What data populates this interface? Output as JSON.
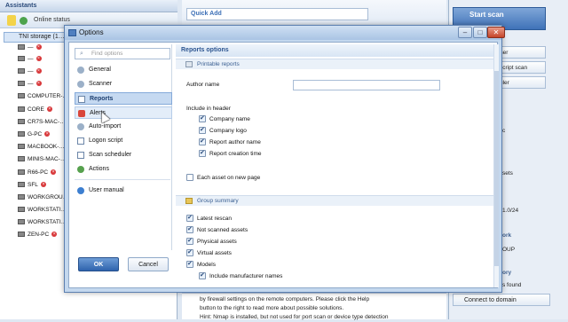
{
  "app": {
    "assistants_title": "Assistants",
    "online_status": "Online status",
    "quick_add": "Quick Add",
    "tree_root": "TNI storage (1…",
    "tree_items": [
      "—",
      "—",
      "—",
      "—",
      "COMPUTER-…",
      "CORE",
      "CR7S-MAC-…",
      "G-PC",
      "MACBOOK-…",
      "MINIS-MAC-…",
      "R66-PC",
      "SFL",
      "WORKGROU…",
      "WORKSTATI…",
      "WORKSTATI…",
      "ZEN-PC"
    ],
    "start_scan": "Start scan",
    "right_buttons": [
      "ner",
      "script scan",
      "uler"
    ],
    "right_texts": [
      "c",
      "sets",
      "1.0/24",
      "ork",
      "OUP",
      "ory",
      "s found"
    ],
    "connect_to_domain": "Connect to domain",
    "bottom_info_1": "by firewall settings on the remote computers. Please click the Help",
    "bottom_info_2": "button to the right to read more about possible solutions.",
    "bottom_info_3": "Hint: Nmap is installed, but not used for port scan or device type detection"
  },
  "dialog": {
    "title": "Options",
    "find_placeholder": "Find options",
    "nav_items": [
      "General",
      "Scanner",
      "Reports",
      "Alerts",
      "Auto-import",
      "Logon script",
      "Scan scheduler",
      "Actions",
      "User manual"
    ],
    "selected_nav": "Reports",
    "ok_label": "OK",
    "cancel_label": "Cancel",
    "reports": {
      "header": "Reports options",
      "printable_section": "Printable reports",
      "author_label": "Author name",
      "author_value": "",
      "include_header_label": "Include in header",
      "header_checks": [
        {
          "label": "Company name",
          "checked": true
        },
        {
          "label": "Company logo",
          "checked": true
        },
        {
          "label": "Report author name",
          "checked": true
        },
        {
          "label": "Report creation time",
          "checked": true
        }
      ],
      "each_asset_label": "Each asset on new page",
      "each_asset_checked": false,
      "group_section": "Group summary",
      "group_checks": [
        {
          "label": "Latest rescan",
          "checked": true
        },
        {
          "label": "Not scanned assets",
          "checked": true
        },
        {
          "label": "Physical assets",
          "checked": true
        },
        {
          "label": "Virtual assets",
          "checked": true
        },
        {
          "label": "Models",
          "checked": true
        },
        {
          "label": "Include manufacturer names",
          "checked": true
        }
      ]
    }
  }
}
